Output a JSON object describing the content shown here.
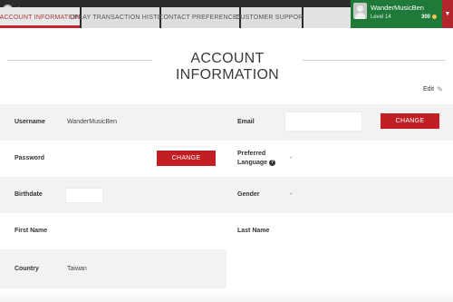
{
  "brand": {
    "logo_text": "play"
  },
  "nav": {
    "tabs": [
      {
        "label": "Account information",
        "active": true
      },
      {
        "label": "Uplay transaction history",
        "active": false
      },
      {
        "label": "Contact preferences",
        "active": false
      },
      {
        "label": "Customer support",
        "active": false
      }
    ]
  },
  "user": {
    "name": "WanderMusicBen",
    "level": "Level 14",
    "points": "300"
  },
  "page": {
    "title": "ACCOUNT INFORMATION",
    "edit_label": "Edit"
  },
  "fields": {
    "username": {
      "label": "Username",
      "value": "WanderMusicBen"
    },
    "email": {
      "label": "Email",
      "value": "",
      "button": "CHANGE"
    },
    "password": {
      "label": "Password",
      "button": "CHANGE"
    },
    "preferred_language": {
      "label": "Preferred Language",
      "value": "-"
    },
    "birthdate": {
      "label": "Birthdate",
      "value": ""
    },
    "gender": {
      "label": "Gender",
      "value": "-"
    },
    "first_name": {
      "label": "First Name",
      "value": ""
    },
    "last_name": {
      "label": "Last Name",
      "value": ""
    },
    "country": {
      "label": "Country",
      "value": "Taiwan"
    }
  },
  "colors": {
    "accent_red": "#c21f24",
    "user_green": "#1f7a3a",
    "topbar": "#2b2b2b"
  }
}
